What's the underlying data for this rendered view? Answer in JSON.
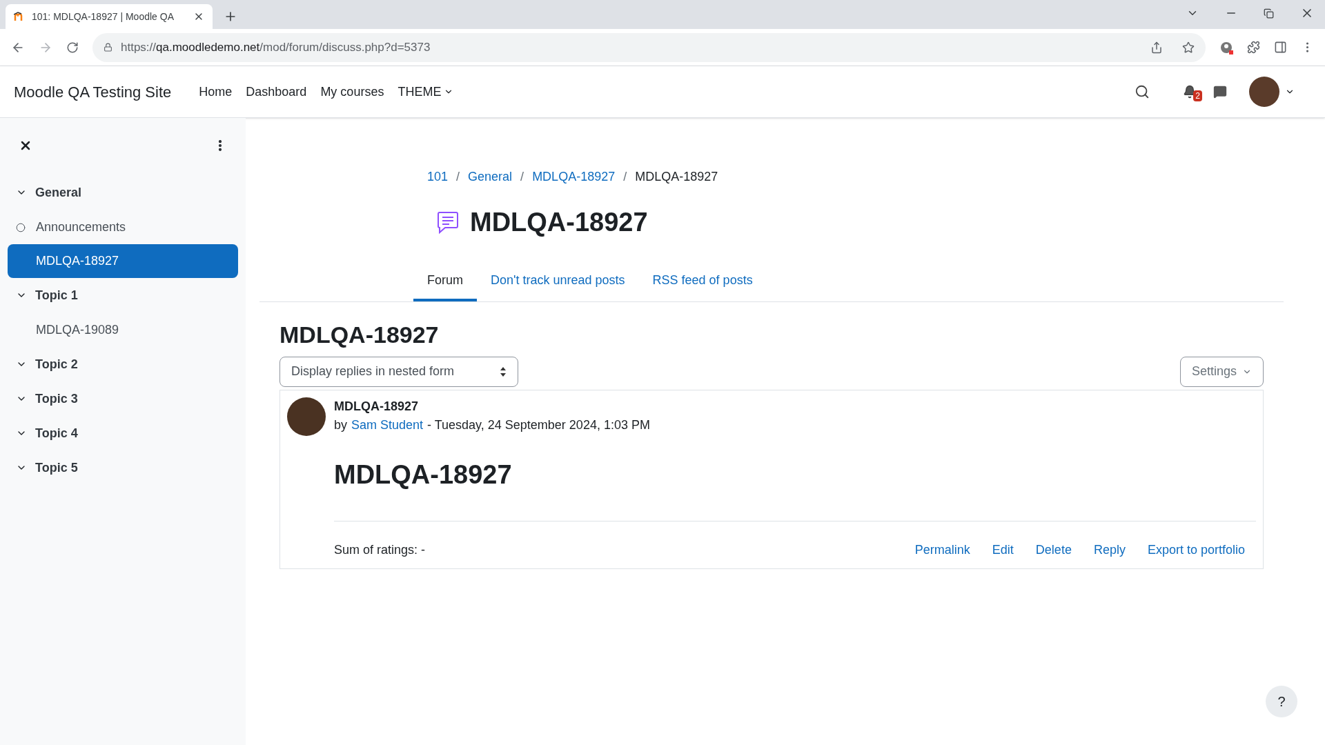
{
  "browser": {
    "tab_title": "101: MDLQA-18927 | Moodle QA",
    "url_scheme": "https://",
    "url_host": "qa.moodledemo.net",
    "url_path": "/mod/forum/discuss.php?d=5373"
  },
  "navbar": {
    "site_name": "Moodle QA Testing Site",
    "links": [
      "Home",
      "Dashboard",
      "My courses",
      "THEME"
    ],
    "notification_count": "2"
  },
  "sidebar": {
    "sections": [
      {
        "title": "General",
        "expanded": true,
        "children": [
          {
            "label": "Announcements",
            "marked": true,
            "selected": false
          },
          {
            "label": "MDLQA-18927",
            "marked": false,
            "selected": true
          }
        ]
      },
      {
        "title": "Topic 1",
        "expanded": true,
        "children": [
          {
            "label": "MDLQA-19089",
            "marked": false,
            "selected": false
          }
        ]
      },
      {
        "title": "Topic 2",
        "expanded": true
      },
      {
        "title": "Topic 3",
        "expanded": true
      },
      {
        "title": "Topic 4",
        "expanded": true
      },
      {
        "title": "Topic 5",
        "expanded": true
      }
    ]
  },
  "breadcrumb": [
    {
      "kind": "link",
      "text": "101"
    },
    {
      "kind": "separator",
      "text": "/"
    },
    {
      "kind": "link",
      "text": "General"
    },
    {
      "kind": "separator",
      "text": "/"
    },
    {
      "kind": "link",
      "text": "MDLQA-18927"
    },
    {
      "kind": "separator",
      "text": "/"
    },
    {
      "kind": "current",
      "text": "MDLQA-18927"
    }
  ],
  "page_title": "MDLQA-18927",
  "tabs": [
    {
      "label": "Forum",
      "selected": true
    },
    {
      "label": "Don't track unread posts",
      "selected": false
    },
    {
      "label": "RSS feed of posts",
      "selected": false
    }
  ],
  "discussion": {
    "heading": "MDLQA-18927",
    "display_mode": "Display replies in nested form",
    "settings_button": "Settings",
    "post": {
      "subject": "MDLQA-18927",
      "by": "by",
      "author": "Sam Student",
      "date": "- Tuesday, 24 September 2024, 1:03 PM",
      "body_heading": "MDLQA-18927",
      "ratings": "Sum of ratings: -",
      "actions": [
        "Permalink",
        "Edit",
        "Delete",
        "Reply",
        "Export to portfolio"
      ]
    }
  },
  "help_button": "?"
}
